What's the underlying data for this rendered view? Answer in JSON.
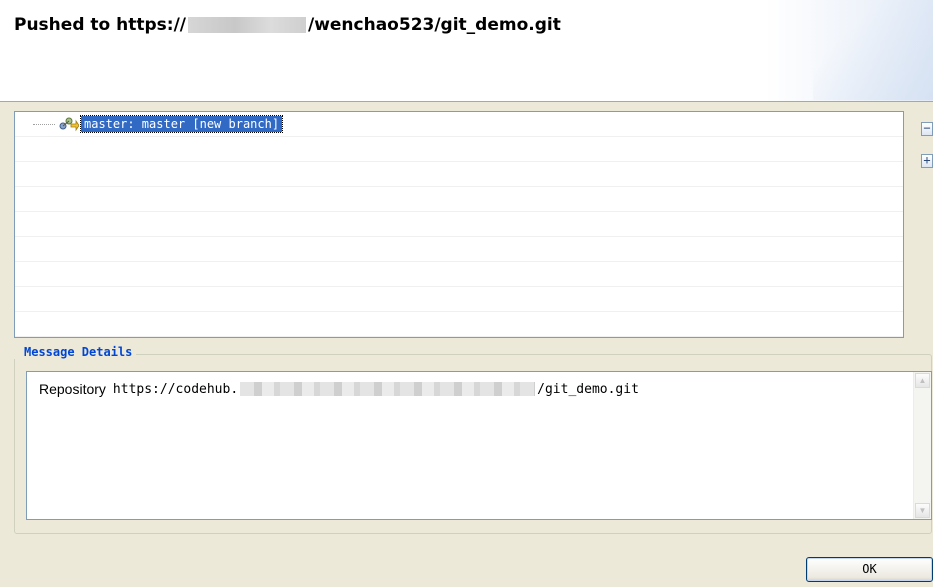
{
  "header": {
    "title_prefix": "Pushed to https://",
    "title_suffix": "/wenchao523/git_demo.git"
  },
  "tree": {
    "items": [
      {
        "label": "master: master [new branch]",
        "icon": "git-branch-push-icon",
        "selected": true
      }
    ],
    "collapse_label": "−",
    "expand_label": "+"
  },
  "message_details": {
    "legend": "Message Details",
    "prefix": "Repository",
    "url_start": "https://codehub.",
    "url_end": "/git_demo.git"
  },
  "buttons": {
    "ok_label": "OK"
  },
  "colors": {
    "selection": "#316ac5",
    "legend": "#0046d5",
    "dialog_bg": "#ece9d8"
  }
}
